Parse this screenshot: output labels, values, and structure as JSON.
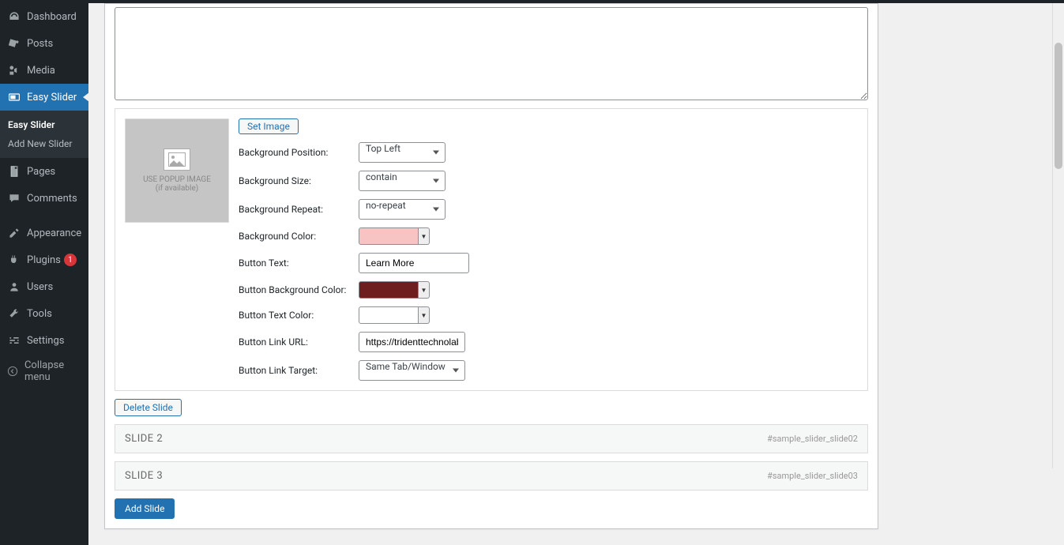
{
  "sidebar": {
    "dashboard": "Dashboard",
    "posts": "Posts",
    "media": "Media",
    "easy_slider": "Easy Slider",
    "sub_easy_slider": "Easy Slider",
    "sub_add_new": "Add New Slider",
    "pages": "Pages",
    "comments": "Comments",
    "appearance": "Appearance",
    "plugins": "Plugins",
    "plugins_badge": "1",
    "users": "Users",
    "tools": "Tools",
    "settings": "Settings",
    "collapse": "Collapse menu"
  },
  "slide": {
    "set_image": "Set Image",
    "placeholder_line1": "USE POPUP IMAGE",
    "placeholder_line2": "(if available)",
    "labels": {
      "bg_position": "Background Position:",
      "bg_size": "Background Size:",
      "bg_repeat": "Background Repeat:",
      "bg_color": "Background Color:",
      "btn_text": "Button Text:",
      "btn_bg_color": "Button Background Color:",
      "btn_text_color": "Button Text Color:",
      "btn_link_url": "Button Link URL:",
      "btn_link_target": "Button Link Target:"
    },
    "values": {
      "bg_position": "Top Left",
      "bg_size": "contain",
      "bg_repeat": "no-repeat",
      "btn_text": "Learn More",
      "btn_link_url": "https://tridenttechnolabs.com",
      "btn_link_target": "Same Tab/Window"
    },
    "colors": {
      "bg_color": "#f7c3c3",
      "btn_bg_color": "#6e1e1e",
      "btn_text_color": "#ffffff"
    },
    "delete": "Delete Slide"
  },
  "slides_collapsed": [
    {
      "title": "SLIDE 2",
      "tag": "#sample_slider_slide02"
    },
    {
      "title": "SLIDE 3",
      "tag": "#sample_slider_slide03"
    }
  ],
  "add_slide": "Add Slide"
}
